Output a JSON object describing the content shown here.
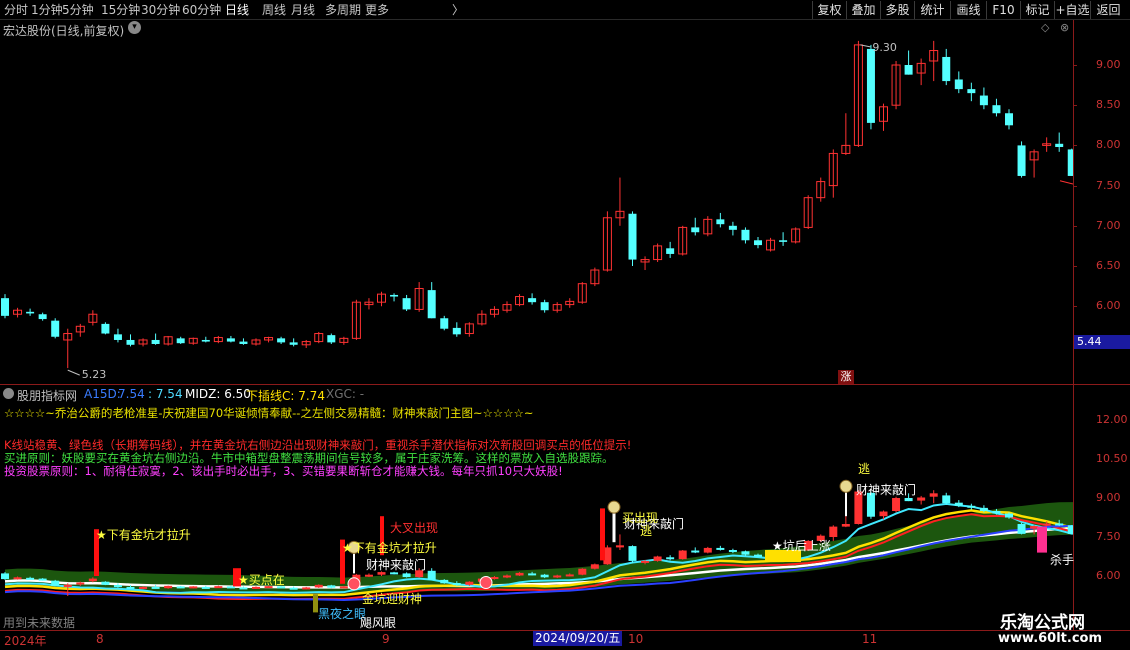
{
  "toolbar": {
    "periods": [
      "分时",
      "1分钟",
      "5分钟",
      "15分钟",
      "30分钟",
      "60分钟",
      "日线",
      "周线",
      "月线",
      "多周期",
      "更多"
    ],
    "active_period": "日线",
    "right_buttons": [
      "复权",
      "叠加",
      "多股",
      "统计",
      "画线",
      "F10",
      "标记",
      "+自选",
      "返回"
    ]
  },
  "main_chart": {
    "title": "宏达股份(日线,前复权)",
    "high_label": "9.30",
    "low_label": "5.23",
    "current_price": "5.44",
    "y_ticks": [
      "9.00",
      "8.50",
      "8.00",
      "7.50",
      "7.00",
      "6.50",
      "6.00"
    ],
    "zhang_label": "涨",
    "ohlc": [
      [
        6.1,
        6.15,
        5.85,
        5.88
      ],
      [
        5.9,
        5.98,
        5.86,
        5.95
      ],
      [
        5.93,
        5.97,
        5.88,
        5.91
      ],
      [
        5.9,
        5.92,
        5.82,
        5.84
      ],
      [
        5.82,
        5.85,
        5.6,
        5.62
      ],
      [
        5.58,
        5.72,
        5.23,
        5.66
      ],
      [
        5.68,
        5.78,
        5.62,
        5.75
      ],
      [
        5.8,
        5.95,
        5.76,
        5.9
      ],
      [
        5.78,
        5.8,
        5.65,
        5.66
      ],
      [
        5.65,
        5.72,
        5.55,
        5.58
      ],
      [
        5.58,
        5.65,
        5.5,
        5.52
      ],
      [
        5.53,
        5.6,
        5.5,
        5.58
      ],
      [
        5.58,
        5.66,
        5.52,
        5.53
      ],
      [
        5.53,
        5.63,
        5.51,
        5.62
      ],
      [
        5.6,
        5.62,
        5.53,
        5.54
      ],
      [
        5.54,
        5.61,
        5.52,
        5.6
      ],
      [
        5.58,
        5.62,
        5.55,
        5.56
      ],
      [
        5.56,
        5.63,
        5.54,
        5.61
      ],
      [
        5.6,
        5.63,
        5.55,
        5.56
      ],
      [
        5.56,
        5.6,
        5.52,
        5.53
      ],
      [
        5.53,
        5.6,
        5.51,
        5.58
      ],
      [
        5.58,
        5.62,
        5.55,
        5.61
      ],
      [
        5.6,
        5.62,
        5.53,
        5.55
      ],
      [
        5.55,
        5.6,
        5.5,
        5.52
      ],
      [
        5.52,
        5.58,
        5.48,
        5.56
      ],
      [
        5.56,
        5.68,
        5.54,
        5.66
      ],
      [
        5.64,
        5.66,
        5.53,
        5.55
      ],
      [
        5.55,
        5.62,
        5.52,
        5.6
      ],
      [
        5.6,
        6.08,
        5.58,
        6.05
      ],
      [
        6.02,
        6.1,
        5.96,
        6.05
      ],
      [
        6.05,
        6.18,
        6.0,
        6.15
      ],
      [
        6.14,
        6.16,
        6.06,
        6.12
      ],
      [
        6.1,
        6.14,
        5.94,
        5.96
      ],
      [
        5.96,
        6.3,
        5.93,
        6.22
      ],
      [
        6.2,
        6.3,
        5.85,
        5.85
      ],
      [
        5.85,
        5.88,
        5.7,
        5.72
      ],
      [
        5.73,
        5.8,
        5.62,
        5.65
      ],
      [
        5.66,
        5.8,
        5.62,
        5.78
      ],
      [
        5.78,
        5.95,
        5.76,
        5.9
      ],
      [
        5.9,
        6.0,
        5.86,
        5.96
      ],
      [
        5.95,
        6.06,
        5.92,
        6.02
      ],
      [
        6.02,
        6.15,
        6.0,
        6.12
      ],
      [
        6.1,
        6.16,
        6.02,
        6.05
      ],
      [
        6.05,
        6.08,
        5.92,
        5.95
      ],
      [
        5.95,
        6.05,
        5.92,
        6.02
      ],
      [
        6.02,
        6.1,
        5.98,
        6.06
      ],
      [
        6.05,
        6.3,
        6.03,
        6.28
      ],
      [
        6.28,
        6.48,
        6.25,
        6.45
      ],
      [
        6.45,
        7.18,
        6.43,
        7.1
      ],
      [
        7.1,
        7.6,
        7.0,
        7.18
      ],
      [
        7.15,
        7.18,
        6.5,
        6.58
      ],
      [
        6.55,
        6.62,
        6.45,
        6.58
      ],
      [
        6.58,
        6.78,
        6.55,
        6.75
      ],
      [
        6.72,
        6.8,
        6.6,
        6.65
      ],
      [
        6.65,
        7.0,
        6.63,
        6.98
      ],
      [
        6.98,
        7.1,
        6.88,
        6.92
      ],
      [
        6.9,
        7.12,
        6.87,
        7.08
      ],
      [
        7.08,
        7.16,
        6.98,
        7.02
      ],
      [
        7.0,
        7.05,
        6.88,
        6.95
      ],
      [
        6.95,
        6.98,
        6.78,
        6.82
      ],
      [
        6.82,
        6.86,
        6.72,
        6.76
      ],
      [
        6.7,
        6.85,
        6.68,
        6.82
      ],
      [
        6.82,
        6.92,
        6.75,
        6.8
      ],
      [
        6.8,
        6.98,
        6.78,
        6.96
      ],
      [
        6.98,
        7.38,
        6.96,
        7.35
      ],
      [
        7.35,
        7.6,
        7.3,
        7.55
      ],
      [
        7.5,
        7.95,
        7.35,
        7.9
      ],
      [
        7.9,
        8.4,
        7.88,
        8.0
      ],
      [
        8.0,
        9.3,
        7.98,
        9.25
      ],
      [
        9.2,
        9.25,
        8.2,
        8.28
      ],
      [
        8.3,
        8.52,
        8.18,
        8.48
      ],
      [
        8.5,
        9.05,
        8.45,
        9.0
      ],
      [
        9.0,
        9.18,
        8.88,
        8.88
      ],
      [
        8.9,
        9.08,
        8.75,
        9.02
      ],
      [
        9.05,
        9.3,
        8.8,
        9.18
      ],
      [
        9.1,
        9.2,
        8.75,
        8.8
      ],
      [
        8.82,
        8.92,
        8.65,
        8.7
      ],
      [
        8.7,
        8.78,
        8.55,
        8.65
      ],
      [
        8.62,
        8.72,
        8.45,
        8.5
      ],
      [
        8.5,
        8.58,
        8.36,
        8.4
      ],
      [
        8.4,
        8.45,
        8.2,
        8.25
      ],
      [
        8.0,
        8.05,
        7.6,
        7.62
      ],
      [
        7.82,
        7.95,
        7.6,
        7.92
      ],
      [
        8.0,
        8.1,
        7.92,
        8.02
      ],
      [
        8.02,
        8.16,
        7.92,
        7.98
      ],
      [
        7.95,
        7.96,
        7.62,
        7.62
      ],
      [
        7.6,
        7.62,
        7.55,
        7.56
      ]
    ]
  },
  "indicator": {
    "name": "股朋指标网",
    "a_label": "A15D:",
    "a_value": "7.54",
    "b_value": ": 7.54",
    "midz": "MIDZ: 6.50",
    "xiacha": "下插线C: 7.74",
    "xgc": "XGC: -",
    "banner": "☆☆☆☆~乔治公爵的老枪准星-庆祝建国70华诞倾情奉献--之左侧交易精髓：财神来敲门主图~☆☆☆☆~",
    "line1": "K线站稳黄、绿色线（长期筹码线），并在黄金坑右侧边沿出现财神来敲门，重视杀手潜伏指标对次新股回调买点的低位提示!",
    "line2": "买进原则：妖股要买在黄金坑右侧边沿。牛市中箱型盘整震荡期间信号较多，属于庄家洗筹。这样的票放入自选股跟踪。",
    "line3": "投资股票原则：1、耐得住寂寞，2、该出手时必出手，3、买错要果断斩仓才能赚大钱。每年只抓10只大妖股!",
    "y_ticks": [
      "12.00",
      "10.50",
      "9.00",
      "7.50",
      "6.00"
    ],
    "signals": {
      "xia_you_1": "★下有金坑才拉升",
      "xia_you_2": "★下有金坑才拉升",
      "buy_point": "★买点在",
      "caishen_1": "财神来敲门",
      "caishen_2": "财神来敲门",
      "caishen_3": "财神来敲门",
      "dacha": "大叉出现",
      "kengbian": "金坑迎财神",
      "heiye": "黑夜之眼",
      "taifeng": "飓风眼",
      "kenghou": "★坑后上涨",
      "sell_1": "买出现",
      "tao": "逃",
      "tao2": "逃",
      "shashou": "杀手"
    },
    "future_note": "用到未来数据"
  },
  "date_axis": {
    "labels": [
      "2024年",
      "8",
      "9",
      "2024/09/20/五",
      "10",
      "11"
    ]
  },
  "watermark": {
    "name": "乐淘公式网",
    "url": "www.60lt.com"
  }
}
